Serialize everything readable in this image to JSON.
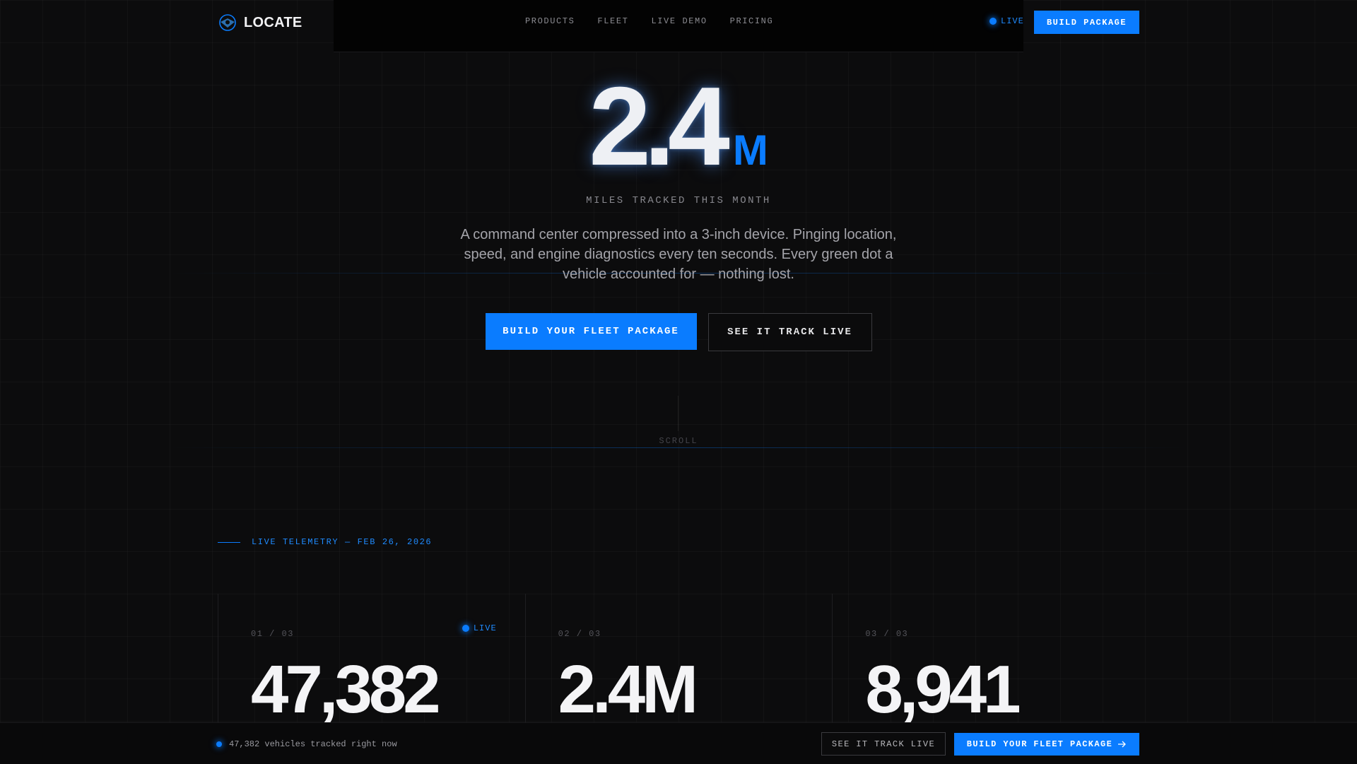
{
  "header": {
    "brand": "LOCATE",
    "nav": [
      "PRODUCTS",
      "FLEET",
      "LIVE DEMO",
      "PRICING"
    ],
    "live_label": "LIVE",
    "cta_label": "BUILD PACKAGE"
  },
  "hero": {
    "value": "2.4",
    "unit": "M",
    "subtitle": "MILES TRACKED THIS MONTH",
    "description": "A command center compressed into a 3-inch device. Pinging location, speed, and engine diagnostics every ten seconds. Every green dot a vehicle accounted for — nothing lost.",
    "primary_cta": "BUILD YOUR FLEET PACKAGE",
    "secondary_cta": "SEE IT TRACK LIVE",
    "scroll_label": "SCROLL"
  },
  "telemetry": {
    "label": "LIVE TELEMETRY — FEB 26, 2026",
    "cards": [
      {
        "index": "01 / 03",
        "value": "47,382",
        "live": "LIVE"
      },
      {
        "index": "02 / 03",
        "value": "2.4M"
      },
      {
        "index": "03 / 03",
        "value": "8,941"
      }
    ]
  },
  "bottom_bar": {
    "status": "47,382 vehicles tracked right now",
    "secondary_cta": "SEE IT TRACK LIVE",
    "primary_cta": "BUILD YOUR FLEET PACKAGE",
    "arrow_icon": "arrow-right-icon"
  },
  "colors": {
    "accent": "#0a7cff",
    "background": "#0c0c0d"
  }
}
